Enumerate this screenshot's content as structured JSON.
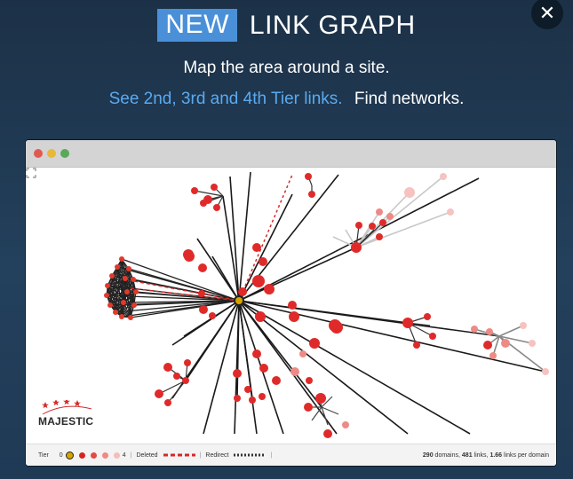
{
  "header": {
    "badge": "NEW",
    "title": "LINK GRAPH",
    "subtitle": "Map the area around a site.",
    "tagline_highlight": "See 2nd, 3rd and 4th Tier links.",
    "tagline_plain": "Find networks."
  },
  "close_label": "✕",
  "browser": {
    "logo_text": "MAJESTIC",
    "legend": {
      "tier_label": "Tier",
      "tier_min": "0",
      "tier_max": "4",
      "deleted_label": "Deleted",
      "redirect_label": "Redirect",
      "stats": {
        "domains": "290",
        "domains_label": "domains,",
        "links": "481",
        "links_label": "links,",
        "ratio": "1.66",
        "ratio_label": "links per domain"
      }
    }
  },
  "colors": {
    "accent": "#4a90d9",
    "highlight_text": "#5aaaf0",
    "node_red": "#e02a2a",
    "center_node": "#d9a300"
  },
  "icons": [
    "close-icon",
    "expand-icon",
    "majestic-logo-icon"
  ]
}
